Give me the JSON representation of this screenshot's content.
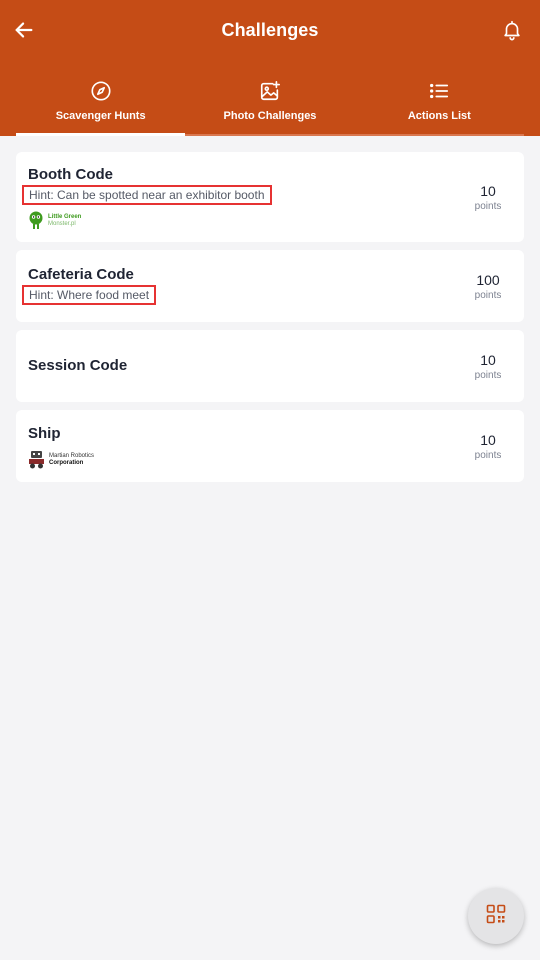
{
  "header": {
    "title": "Challenges",
    "back_icon": "arrow-left-icon",
    "notification_icon": "bell-icon"
  },
  "tabs": [
    {
      "label": "Scavenger Hunts",
      "icon": "compass-icon",
      "active": true
    },
    {
      "label": "Photo Challenges",
      "icon": "image-plus-icon",
      "active": false
    },
    {
      "label": "Actions List",
      "icon": "list-icon",
      "active": false
    }
  ],
  "challenges": [
    {
      "name": "Booth Code",
      "hint": "Hint: Can be spotted near an exhibitor booth",
      "points": "10",
      "points_label": "points",
      "sponsor": {
        "line1": "Little Green",
        "line2": "Monster.pl"
      }
    },
    {
      "name": "Cafeteria Code",
      "hint": "Hint: Where food meet",
      "points": "100",
      "points_label": "points"
    },
    {
      "name": "Session Code",
      "points": "10",
      "points_label": "points"
    },
    {
      "name": "Ship",
      "points": "10",
      "points_label": "points",
      "sponsor": {
        "line1": "Martian Robotics",
        "line2": "Corporation"
      }
    }
  ],
  "fab": {
    "icon": "qr-code-icon"
  },
  "colors": {
    "brand": "#c54c16",
    "background": "#f4f4f6",
    "hint_outline": "#e63232",
    "fab_icon": "#c54c16"
  }
}
